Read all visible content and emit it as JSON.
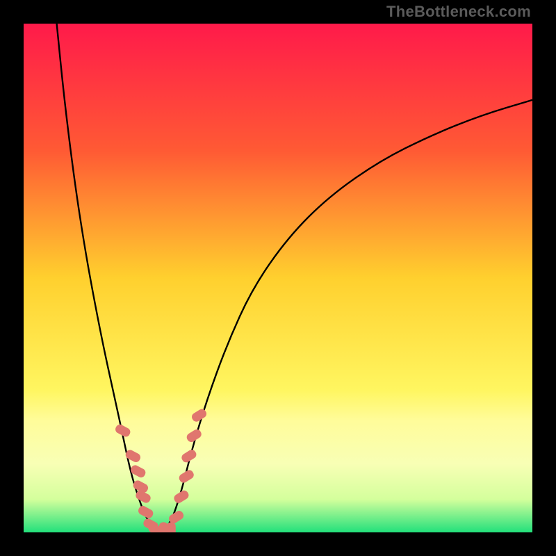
{
  "watermark": "TheBottleneck.com",
  "chart_data": {
    "type": "line",
    "title": "",
    "xlabel": "",
    "ylabel": "",
    "xlim": [
      0,
      100
    ],
    "ylim": [
      0,
      100
    ],
    "grid": false,
    "legend": false,
    "background_gradient_stops": [
      {
        "pos": 0.0,
        "color": "#ff1a4a"
      },
      {
        "pos": 0.25,
        "color": "#ff5a34"
      },
      {
        "pos": 0.5,
        "color": "#ffd02e"
      },
      {
        "pos": 0.72,
        "color": "#fff660"
      },
      {
        "pos": 0.78,
        "color": "#fffc9a"
      },
      {
        "pos": 0.865,
        "color": "#f8ffb5"
      },
      {
        "pos": 0.935,
        "color": "#d4ff9c"
      },
      {
        "pos": 1.0,
        "color": "#22e07b"
      }
    ],
    "series": [
      {
        "name": "left-branch",
        "x": [
          6.5,
          8.0,
          10.0,
          12.0,
          14.0,
          16.0,
          18.0,
          19.5,
          21.0,
          22.5,
          24.0,
          25.5,
          27.0
        ],
        "values": [
          100,
          85,
          69,
          56,
          45,
          35,
          26,
          19,
          12,
          7,
          3,
          1,
          0
        ]
      },
      {
        "name": "right-branch",
        "x": [
          27.0,
          29.0,
          31.0,
          33.0,
          36.0,
          40.0,
          45.0,
          52.0,
          60.0,
          70.0,
          80.0,
          90.0,
          100.0
        ],
        "values": [
          0,
          2,
          8,
          16,
          26,
          37,
          48,
          58,
          66,
          73,
          78,
          82,
          85
        ]
      }
    ],
    "curve_color": "#000000",
    "markers": {
      "color": "#e0766e",
      "shape": "rounded-rect",
      "points": [
        {
          "x": 19.5,
          "y": 20
        },
        {
          "x": 21.5,
          "y": 15
        },
        {
          "x": 22.5,
          "y": 12
        },
        {
          "x": 23.0,
          "y": 9
        },
        {
          "x": 23.5,
          "y": 7
        },
        {
          "x": 24.0,
          "y": 4
        },
        {
          "x": 25.0,
          "y": 1.5
        },
        {
          "x": 26.0,
          "y": 0.5
        },
        {
          "x": 27.5,
          "y": 0.5
        },
        {
          "x": 29.0,
          "y": 0.5
        },
        {
          "x": 30.0,
          "y": 3
        },
        {
          "x": 31.0,
          "y": 7
        },
        {
          "x": 32.0,
          "y": 11
        },
        {
          "x": 32.5,
          "y": 15
        },
        {
          "x": 33.5,
          "y": 19
        },
        {
          "x": 34.5,
          "y": 23
        }
      ]
    }
  }
}
